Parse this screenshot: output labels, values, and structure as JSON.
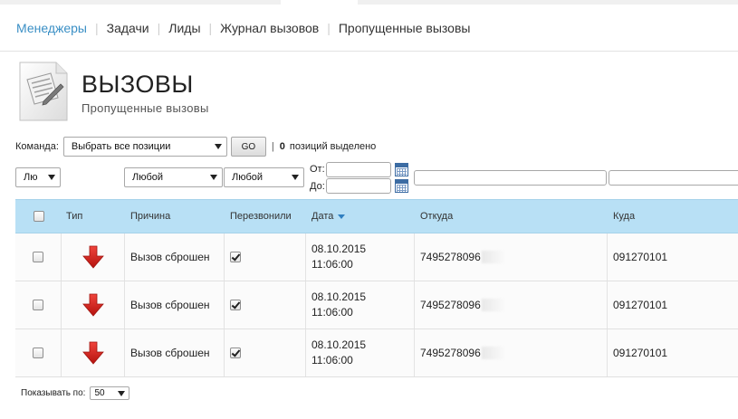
{
  "nav": {
    "items": [
      {
        "label": "Менеджеры",
        "active": true
      },
      {
        "label": "Задачи",
        "active": false
      },
      {
        "label": "Лиды",
        "active": false
      },
      {
        "label": "Журнал вызовов",
        "active": false
      },
      {
        "label": "Пропущенные вызовы",
        "active": false
      }
    ]
  },
  "header": {
    "title": "ВЫЗОВЫ",
    "subtitle": "Пропущенные вызовы"
  },
  "command": {
    "label": "Команда:",
    "selected": "Выбрать все позиции",
    "go_label": "GO",
    "separator": "|",
    "selected_count": "0",
    "selected_text": "позиций выделено"
  },
  "filters": {
    "type_value": "Лю",
    "reason_value": "Любой",
    "called_back_value": "Любой",
    "date_from_label": "От:",
    "date_to_label": "До:",
    "date_from_value": "",
    "date_to_value": "",
    "from_value": "",
    "to_value": ""
  },
  "table": {
    "headers": {
      "type": "Тип",
      "reason": "Причина",
      "called_back": "Перезвонили",
      "date": "Дата",
      "from": "Откуда",
      "to": "Куда"
    },
    "rows": [
      {
        "checked": false,
        "reason": "Вызов сброшен",
        "called_back": true,
        "date": "08.10.2015",
        "time": "11:06:00",
        "from": "7495278096",
        "to": "091270101"
      },
      {
        "checked": false,
        "reason": "Вызов сброшен",
        "called_back": true,
        "date": "08.10.2015",
        "time": "11:06:00",
        "from": "7495278096",
        "to": "091270101"
      },
      {
        "checked": false,
        "reason": "Вызов сброшен",
        "called_back": true,
        "date": "08.10.2015",
        "time": "11:06:00",
        "from": "7495278096",
        "to": "091270101"
      }
    ]
  },
  "footer": {
    "per_page_label": "Показывать по:",
    "per_page_value": "50"
  },
  "colors": {
    "accent": "#3a8fc5",
    "header_bg": "#b8e0f5",
    "arrow_red": "#d9241e"
  },
  "icons": {
    "page": "document-pencil-icon",
    "row_type": "arrow-down-red-icon",
    "calendar": "calendar-icon",
    "sort": "sort-desc-icon"
  }
}
